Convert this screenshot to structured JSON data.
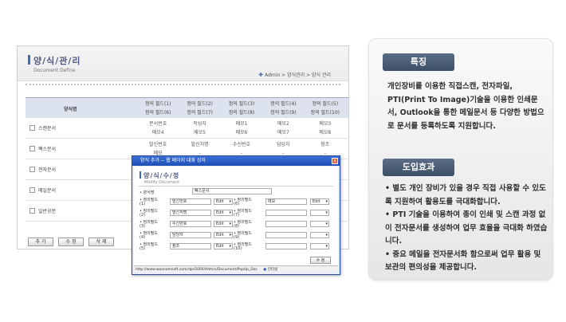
{
  "admin": {
    "title": "양/식/관/리",
    "subtitle": "Document Define",
    "breadcrumb": "Admin > 양식관리 > 양식 관리",
    "header_name": "양식명",
    "header_fields_1": [
      "정의 필드(1)",
      "정의 필드(2)",
      "정의 필드(3)",
      "정의 필드(4)",
      "정의 필드(5)"
    ],
    "header_fields_2": [
      "정의 필드(6)",
      "정의 필드(7)",
      "정의 필드(8)",
      "정의 필드(9)",
      "정의 필드(10)"
    ],
    "rows": [
      {
        "name": "스캔문서",
        "vals1": [
          "문서번호",
          "작성자",
          "메모1",
          "메모2",
          "메모3"
        ],
        "vals2": [
          "메모4",
          "메모5",
          "메모6",
          "메모7",
          "메모8"
        ]
      },
      {
        "name": "팩스문서",
        "vals1": [
          "발신번호",
          "발신처명",
          "수신번호",
          "담당자",
          "참조"
        ],
        "vals2": [
          "메모",
          "-",
          "-",
          "-",
          "-"
        ]
      },
      {
        "name": "전자문서",
        "vals1": [],
        "vals2": []
      },
      {
        "name": "메일문서",
        "vals1": [],
        "vals2": []
      },
      {
        "name": "일반공문",
        "vals1": [],
        "vals2": []
      }
    ],
    "buttons": [
      "추 가",
      "수 정",
      "삭 제"
    ]
  },
  "popup": {
    "window_title": "양식 추가 -- 웹 페이지 대화 상자",
    "close": "X",
    "title": "양/식/수/정",
    "subtitle": "Modify Document",
    "form_name_label": "• 양식명",
    "form_name_value": "팩스문서",
    "left_fields": [
      {
        "label_1": "• 정의필드",
        "label_2": "(1)",
        "value": "발신번호",
        "type": "Edit"
      },
      {
        "label_1": "• 정의필드",
        "label_2": "(2)",
        "value": "발신처명",
        "type": "Edit"
      },
      {
        "label_1": "• 정의필드",
        "label_2": "(3)",
        "value": "수신번호",
        "type": "Edit"
      },
      {
        "label_1": "• 정의필드",
        "label_2": "(4)",
        "value": "담당자",
        "type": "Edit"
      },
      {
        "label_1": "• 정의필드",
        "label_2": "(5)",
        "value": "참조",
        "type": "Edit"
      }
    ],
    "right_fields": [
      {
        "label_1": "• 정의필드",
        "label_2": "(6)",
        "value": "메모",
        "type": "Edit"
      },
      {
        "label_1": "• 정의필드",
        "label_2": "(7)",
        "value": "",
        "type": ""
      },
      {
        "label_1": "• 정의필드",
        "label_2": "(8)",
        "value": "",
        "type": ""
      },
      {
        "label_1": "• 정의필드",
        "label_2": "(9)",
        "value": "",
        "type": ""
      },
      {
        "label_1": "• 정의필드",
        "label_2": "(10)",
        "value": "",
        "type": ""
      }
    ],
    "save_label": "수 정",
    "status_url": "http://www.woonamsoft.com/dps5000/Admin/Document/PopUp_Doc",
    "status_zone": "인터넷"
  },
  "panel": {
    "feature_heading": "특징",
    "feature_text": "개인장비를 이용한 직접스캔, 전자파일, PTI(Print To Image)기술을 이용한 인쇄문서, Outlook을 통한 메일문서 등 다양한 방법으로 문서를 등록하도록 지원합니다.",
    "effect_heading": "도입효과",
    "effects": [
      "• 별도 개인 장비가 있을 경우 직접 사용할 수 있도록 지원하여 활용도를 극대화합니다.",
      "• PTI 기술을 이용하여 종이 인쇄 및 스캔 과정 없이 전자문서를 생성하여 업무 효율을 극대화 하였습니다.",
      "• 중요 메일을 전자문서화 함으로써 업무 활용 및 보관의 편의성을 제공합니다."
    ]
  }
}
